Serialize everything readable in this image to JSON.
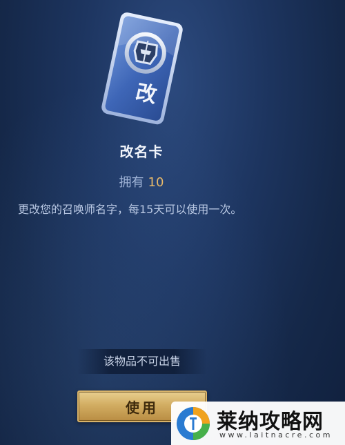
{
  "item": {
    "card_glyph": "改",
    "card_icon": "helmet-icon",
    "name": "改名卡",
    "owned_label": "拥有",
    "owned_count": "10",
    "description": "更改您的召唤师名字，每15天可以使用一次。"
  },
  "footer": {
    "not_for_sale": "该物品不可出售",
    "use_label": "使用"
  },
  "watermark": {
    "name": "莱纳攻略网",
    "url": "www.laitnacre.com"
  },
  "colors": {
    "accent_gold": "#e7b96a",
    "button_gold": "#d2ad62",
    "background": "#1d3560"
  }
}
